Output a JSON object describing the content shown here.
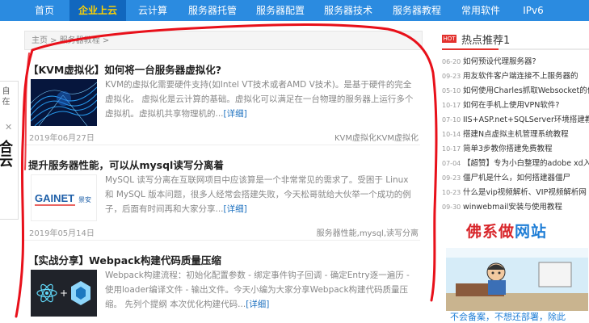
{
  "nav": {
    "items": [
      {
        "label": "首页"
      },
      {
        "label": "企业上云"
      },
      {
        "label": "云计算"
      },
      {
        "label": "服务器托管"
      },
      {
        "label": "服务器配置"
      },
      {
        "label": "服务器技术"
      },
      {
        "label": "服务器教程"
      },
      {
        "label": "常用软件"
      },
      {
        "label": "IPv6"
      }
    ]
  },
  "float_widget": {
    "small_text": "自 在",
    "close": "✕",
    "big_text": "合云"
  },
  "breadcrumb": "主页 > 服务器教程 >",
  "articles": [
    {
      "title": "【KVM虚拟化】如何将一台服务器虚拟化?",
      "summary": "KVM的虚拟化需要硬件支持(如Intel VT技术或者AMD V技术)。是基于硬件的完全虚拟化。 虚拟化是云计算的基础。虚拟化可以满足在一台物理的服务器上运行多个虚拟机。虚拟机共享物理机的...",
      "more": "[详细]",
      "date": "2019年06月27日",
      "tags": "KVM虚拟化KVM虚拟化"
    },
    {
      "title": "提升服务器性能，可以从mysql读写分离着",
      "summary": "MySQL 读写分离在互联网项目中应该算是一个非常常见的需求了。受困于 Linux 和 MySQL 版本问题，很多人经常会搭建失败，今天松哥就给大伙举一个成功的例子，后面有时间再和大家分享...",
      "more": "[详细]",
      "date": "2019年05月14日",
      "tags": "服务器性能,mysql,读写分离",
      "logo_text": "GAINET",
      "logo_sub": "景安"
    },
    {
      "title": "【实战分享】Webpack构建代码质量压缩",
      "summary": "Webpack构建流程：初始化配置参数 - 绑定事件钩子回调 - 确定Entry逐一遍历 - 使用loader编译文件 - 输出文件。今天小编为大家分享Webpack构建代码质量压缩。 先列个提纲 本次优化构建代码...",
      "more": "[详细]"
    }
  ],
  "sidebar": {
    "badge": "HOT",
    "title": "热点推荐1",
    "items": [
      {
        "date": "06-20",
        "text": "如何预设代理服务器?"
      },
      {
        "date": "09-23",
        "text": "用友软件客户端连接不上服务器的"
      },
      {
        "date": "05-10",
        "text": "如何使用Charles抓取Websocket的信息"
      },
      {
        "date": "10-17",
        "text": "如何在手机上使用VPN软件?"
      },
      {
        "date": "07-10",
        "text": "IIS+ASP.net+SQLServer环境搭建教程"
      },
      {
        "date": "10-14",
        "text": "搭建N点虚拟主机管理系统教程"
      },
      {
        "date": "10-17",
        "text": "简单3步教你搭建免费教程"
      },
      {
        "date": "07-04",
        "text": "【超赞】专为小白整理的adobe xd入"
      },
      {
        "date": "09-23",
        "text": "僵尸机是什么，如何搭建器僵尸"
      },
      {
        "date": "10-23",
        "text": "什么是vip视频解析、VIP视频解析网"
      },
      {
        "date": "09-30",
        "text": "winwebmail安装与使用教程"
      }
    ],
    "brand_part1": "佛系做",
    "brand_part2": "网站",
    "banner_caption": "不会备案，不想还部署，除此"
  },
  "colors": {
    "nav_bg": "#2b8be0",
    "nav_active_bg": "#1167be",
    "nav_active_text": "#ffd200",
    "hot_red": "#e3322e",
    "link_blue": "#1a6fbf",
    "annotation_red": "#e8101a"
  }
}
